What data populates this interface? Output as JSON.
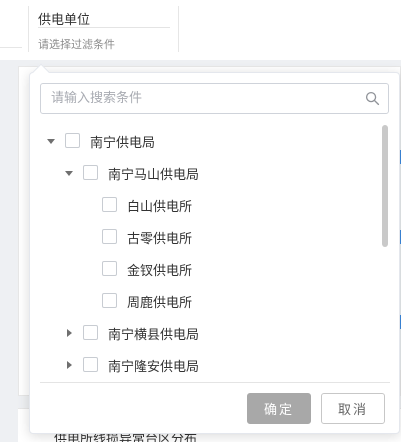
{
  "filter": {
    "label": "供电单位",
    "value_placeholder": "请选择过滤条件"
  },
  "dropdown": {
    "search_placeholder": "请输入搜索条件",
    "tree": [
      {
        "label": "南宁供电局",
        "expanded": true,
        "checked": false
      },
      {
        "label": "南宁马山供电局",
        "expanded": true,
        "checked": false
      },
      {
        "label": "白山供电所",
        "checked": false
      },
      {
        "label": "古零供电所",
        "checked": false
      },
      {
        "label": "金钗供电所",
        "checked": false
      },
      {
        "label": "周鹿供电所",
        "checked": false
      },
      {
        "label": "南宁横县供电局",
        "expanded": false,
        "checked": false
      },
      {
        "label": "南宁隆安供电局",
        "expanded": false,
        "checked": false
      }
    ],
    "confirm_label": "确定",
    "cancel_label": "取消"
  },
  "background": {
    "bottom_text": "供电所线损异常台区分布"
  },
  "colors": {
    "confirm_bg": "#a8a8a8",
    "accent": "#3c8ae0"
  },
  "icons": {
    "search": "search-icon",
    "expanded": "caret-down-icon",
    "collapsed": "caret-right-icon"
  }
}
